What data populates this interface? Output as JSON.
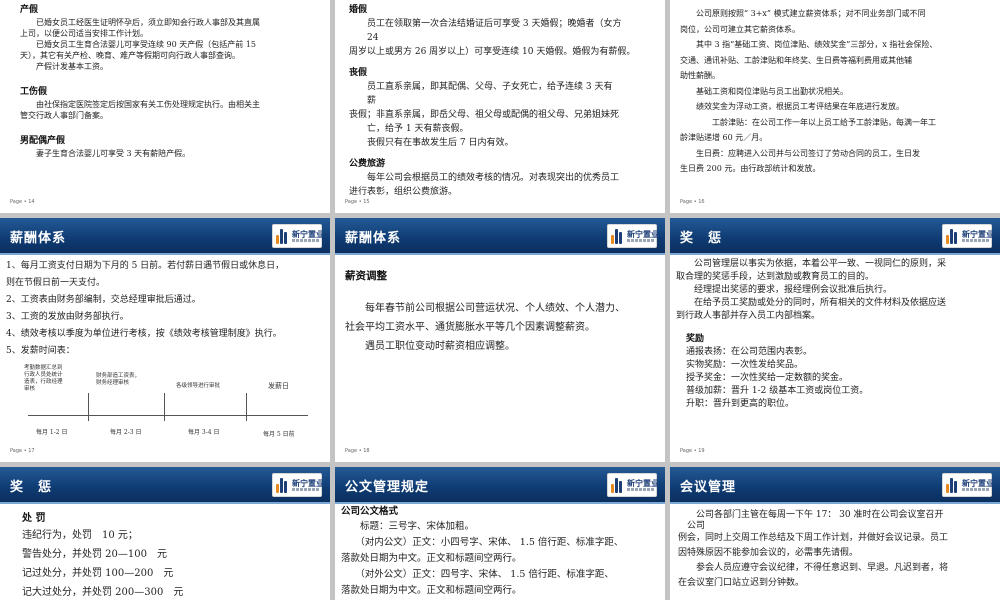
{
  "colors": {
    "header": "#0f3b73",
    "accent": "#7aa7d4",
    "background": "#c4c4c4"
  },
  "logo": {
    "text": "新宁置业",
    "icon": "company-logo"
  },
  "slide14": {
    "page": "Page • 14",
    "sections": [
      {
        "heading": "产假",
        "lines": [
          "　　已婚女员工经医生证明怀孕后，须立即知会行政人事部及其直属",
          "上司，以便公司适当安排工作计划。",
          "　　已婚女员工生育合法婴儿可享受连续 90 天产假（包括产前 15",
          "天），其它有关产检、晚育、难产等假期可向行政人事部查询。",
          "　　产假计发基本工资。"
        ]
      },
      {
        "heading": "工伤假",
        "lines": [
          "　　由社保指定医院签定后按国家有关工伤处理规定执行。由相关主",
          "管交行政人事部门备案。"
        ]
      },
      {
        "heading": "男配偶产假",
        "lines": [
          "　　妻子生育合法婴儿可享受 3 天有薪陪产假。"
        ]
      }
    ]
  },
  "slide15": {
    "page": "Page • 15",
    "sections": [
      {
        "heading": "婚假",
        "lines": [
          "　　员工在领取第一次合法结婚证后可享受 3 天婚假；晚婚者（女方",
          "　　24",
          "周岁以上或男方 26 周岁以上）可享受连续 10 天婚假。婚假为有薪假。"
        ]
      },
      {
        "heading": "丧假",
        "lines": [
          "　　员工直系亲属，即其配偶、父母、子女死亡，给予连续 3 天有",
          "　　薪",
          "丧假；非直系亲属，即岳父母、祖父母或配偶的祖父母、兄弟姐妹死",
          "　　亡，给予 1 天有薪丧假。",
          "　　丧假只有在事故发生后 7 日内有效。"
        ]
      },
      {
        "heading": "公费旅游",
        "lines": [
          "　　每年公司会根据员工的绩效考核的情况。对表现突出的优秀员工",
          "进行表彰，组织公费旅游。"
        ]
      }
    ]
  },
  "slide16": {
    "page": "Page • 16",
    "lines": [
      "　　公司原则按照“ 3+x” 模式建立薪资体系；对不同业务部门或不同",
      "岗位，公司可建立其它薪资体系。",
      "　　其中 3 指“基础工资、岗位津贴、绩效奖金”三部分，x 指社会保险、",
      "交通、通讯补贴、工龄津贴和年终奖、生日费等福利费用或其他辅",
      "助性薪酬。",
      "　　基础工资和岗位津贴与员工出勤状况相关。",
      "　　绩效奖金为浮动工资，根据员工考评结果在年底进行发放。",
      "　　　　工龄津贴：在公司工作一年以上员工给予工龄津贴，每满一年工",
      "龄津贴递增 60 元／月。",
      "　　生日费：应聘进入公司并与公司签订了劳动合同的员工，生日发",
      "生日费 200 元。由行政部统计和发放。"
    ]
  },
  "slide17": {
    "title": "薪酬体系",
    "page": "Page • 17",
    "lines": [
      "1、每月工资支付日期为下月的 5 日前。若付薪日遇节假日或休息日，",
      "则在节假日前一天支付。",
      "2、工资表由财务部编制，交总经理审批后通过。",
      "3、工资的发放由财务部执行。",
      "4、绩效考核以季度为单位进行考核，按《绩效考核管理制度》执行。",
      "5、发薪时间表："
    ],
    "timeline": [
      {
        "desc": "考勤数据汇总到\n行政人员处统计\n造表，行政经理\n审核",
        "date": "每月 1-2 日"
      },
      {
        "desc": "财务部造工资表，\n财务经理审核",
        "date": "每月 2-3 日"
      },
      {
        "desc": "各级领导进行审批",
        "date": "每月 3-4 日"
      },
      {
        "desc": "发薪日",
        "date": "每月 5 日前"
      }
    ]
  },
  "slide18": {
    "title": "薪酬体系",
    "page": "Page • 18",
    "heading": "薪资调整",
    "lines": [
      "　　每年春节前公司根据公司营运状况、个人绩效、个人潜力、",
      "社会平均工资水平、通货膨胀水平等几个因素调整薪资。",
      "　　遇员工职位变动时薪资相应调整。"
    ]
  },
  "slide19": {
    "title": "奖　惩",
    "page": "Page • 19",
    "lines": [
      "　　公司管理层以事实为依据，本着公平一致、一视同仁的原则，采",
      "取合理的奖惩手段，达到激励或教育员工的目的。",
      "　　经理提出奖惩的要求，报经理例会议批准后执行。",
      "　　在给予员工奖励或处分的同时，所有相关的文件材料及依据应送",
      "到行政人事部并存入员工内部档案。"
    ],
    "heading": "奖励",
    "items": [
      "通报表扬：在公司范围内表彰。",
      "实物奖励：一次性发给奖品。",
      "授予奖金：一次性奖给一定数额的奖金。",
      "普级加薪：晋升 1-2 级基本工资或岗位工资。",
      "升职：晋升到更高的职位。"
    ]
  },
  "slide20": {
    "title": "奖　惩",
    "heading": "处 罚",
    "lines": [
      "违纪行为，处罚　10 元；",
      "警告处分，并处罚 20—100　元",
      "记过处分，并处罚 100—200　元",
      "记大过处分，并处罚 200—300　元"
    ]
  },
  "slide21": {
    "title": "公文管理规定",
    "heading": "公司公文格式",
    "lines": [
      "　　标题：三号字、宋体加粗。",
      "　　（对内公文）正文：小四号字、宋体、 1.5 倍行距、标准字距、",
      "落款处日期为中文。正文和标题间空两行。",
      "　　（对外公文）正文：四号字、宋体、 1.5 倍行距、标准字距、",
      "落款处日期为中文。正文和标题间空两行。"
    ]
  },
  "slide22": {
    "title": "会议管理",
    "lines": [
      "　　公司各部门主管在每周一下午 17： 30 准时在公司会议室召开",
      "　公司",
      "例会，同时上交周工作总结及下周工作计划，并做好会议记录。员工",
      "因特殊原因不能参加会议的，必需事先请假。",
      "",
      "　　参会人员应遵守会议纪律，不得任意迟到、早退。凡迟到者，将",
      "在会议室门口站立迟到分钟数。"
    ]
  }
}
